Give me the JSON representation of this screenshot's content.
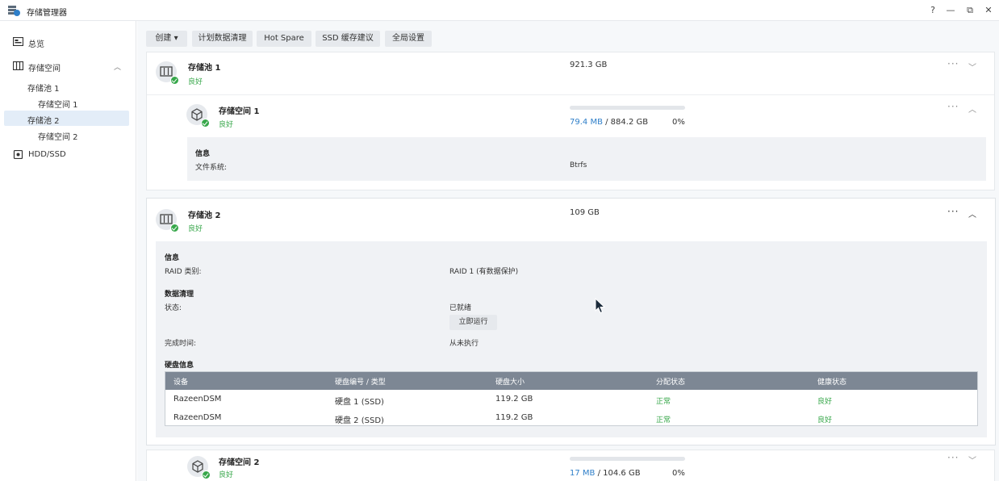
{
  "window": {
    "title": "存储管理器",
    "controls": [
      "?",
      "—",
      "⧉",
      "✕"
    ]
  },
  "sidebar": {
    "items": [
      {
        "label": "总览"
      },
      {
        "label": "存储空间"
      },
      {
        "label": "存储池 1"
      },
      {
        "label": "存储空间 1"
      },
      {
        "label": "存储池 2"
      },
      {
        "label": "存储空间 2"
      },
      {
        "label": "HDD/SSD"
      }
    ]
  },
  "toolbar": {
    "create": "创建 ▾",
    "scrub_schedule": "计划数据清理",
    "hot_spare": "Hot Spare",
    "ssd_cache": "SSD 缓存建议",
    "global_settings": "全局设置"
  },
  "pool1": {
    "name": "存储池 1",
    "status": "良好",
    "size": "921.3 GB",
    "volume": {
      "name": "存储空间 1",
      "status": "良好",
      "used": "79.4 MB",
      "total": "/ 884.2 GB",
      "percent": "0%",
      "usage_fraction": 0.0,
      "info_title": "信息",
      "fs_label": "文件系统:",
      "fs_value": "Btrfs"
    }
  },
  "pool2": {
    "name": "存储池 2",
    "status": "良好",
    "size": "109 GB",
    "info_title": "信息",
    "raid_label": "RAID 类别:",
    "raid_value": "RAID 1 (有数据保护)",
    "scrub_title": "数据清理",
    "scrub_status_label": "状态:",
    "scrub_status_value": "已就绪",
    "run_now": "立即运行",
    "finish_label": "完成时间:",
    "finish_value": "从未执行",
    "disk_info_title": "硬盘信息",
    "disk_table": {
      "headers": [
        "设备",
        "硬盘编号 / 类型",
        "硬盘大小",
        "分配状态",
        "健康状态"
      ],
      "rows": [
        [
          "RazeenDSM",
          "硬盘 1 (SSD)",
          "119.2 GB",
          "正常",
          "良好"
        ],
        [
          "RazeenDSM",
          "硬盘 2 (SSD)",
          "119.2 GB",
          "正常",
          "良好"
        ]
      ]
    },
    "volume": {
      "name": "存储空间 2",
      "status": "良好",
      "used": "17 MB",
      "total": "/ 104.6 GB",
      "percent": "0%",
      "usage_fraction": 0.0
    }
  },
  "colors": {
    "accent": "#2f7fc9",
    "ok_green": "#37a74a",
    "table_header": "#7d8794",
    "active_nav": "#e3edf8"
  },
  "icons": {
    "pool": "storage-pool-icon",
    "volume": "cube-icon",
    "ok": "check-badge-icon"
  }
}
